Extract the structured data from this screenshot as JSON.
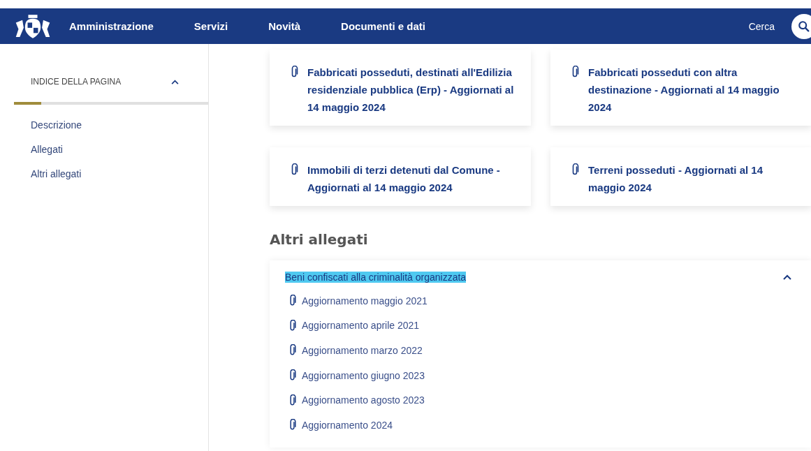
{
  "nav": {
    "items": [
      "Amministrazione",
      "Servizi",
      "Novità",
      "Documenti e dati"
    ],
    "search_label": "Cerca"
  },
  "sidebar": {
    "title": "INDICE DELLA PAGINA",
    "expanded": true,
    "progress": {
      "level": 0.14
    },
    "items": [
      "Descrizione",
      "Allegati",
      "Altri allegati"
    ]
  },
  "attachments": [
    {
      "title": "Fabbricati posseduti, destinati all'Edilizia residenziale pubblica (Erp) - Aggiornati al 14 maggio 2024"
    },
    {
      "title": "Fabbricati posseduti con altra destinazione - Aggiornati al 14 maggio 2024"
    },
    {
      "title": "Immobili di terzi detenuti dal Comune - Aggiornati al 14 maggio 2024"
    },
    {
      "title": "Terreni posseduti - Aggiornati al 14 maggio 2024"
    }
  ],
  "other_attachments": {
    "heading": "Altri allegati",
    "accordion": {
      "title": "Beni confiscati alla criminalità organizzata",
      "highlighted": true,
      "expanded": true,
      "files": [
        "Aggiornamento maggio 2021",
        "Aggiornamento aprile 2021",
        "Aggiornamento marzo 2022",
        "Aggiornamento giugno 2023",
        "Aggiornamento agosto 2023",
        "Aggiornamento 2024"
      ]
    }
  }
}
